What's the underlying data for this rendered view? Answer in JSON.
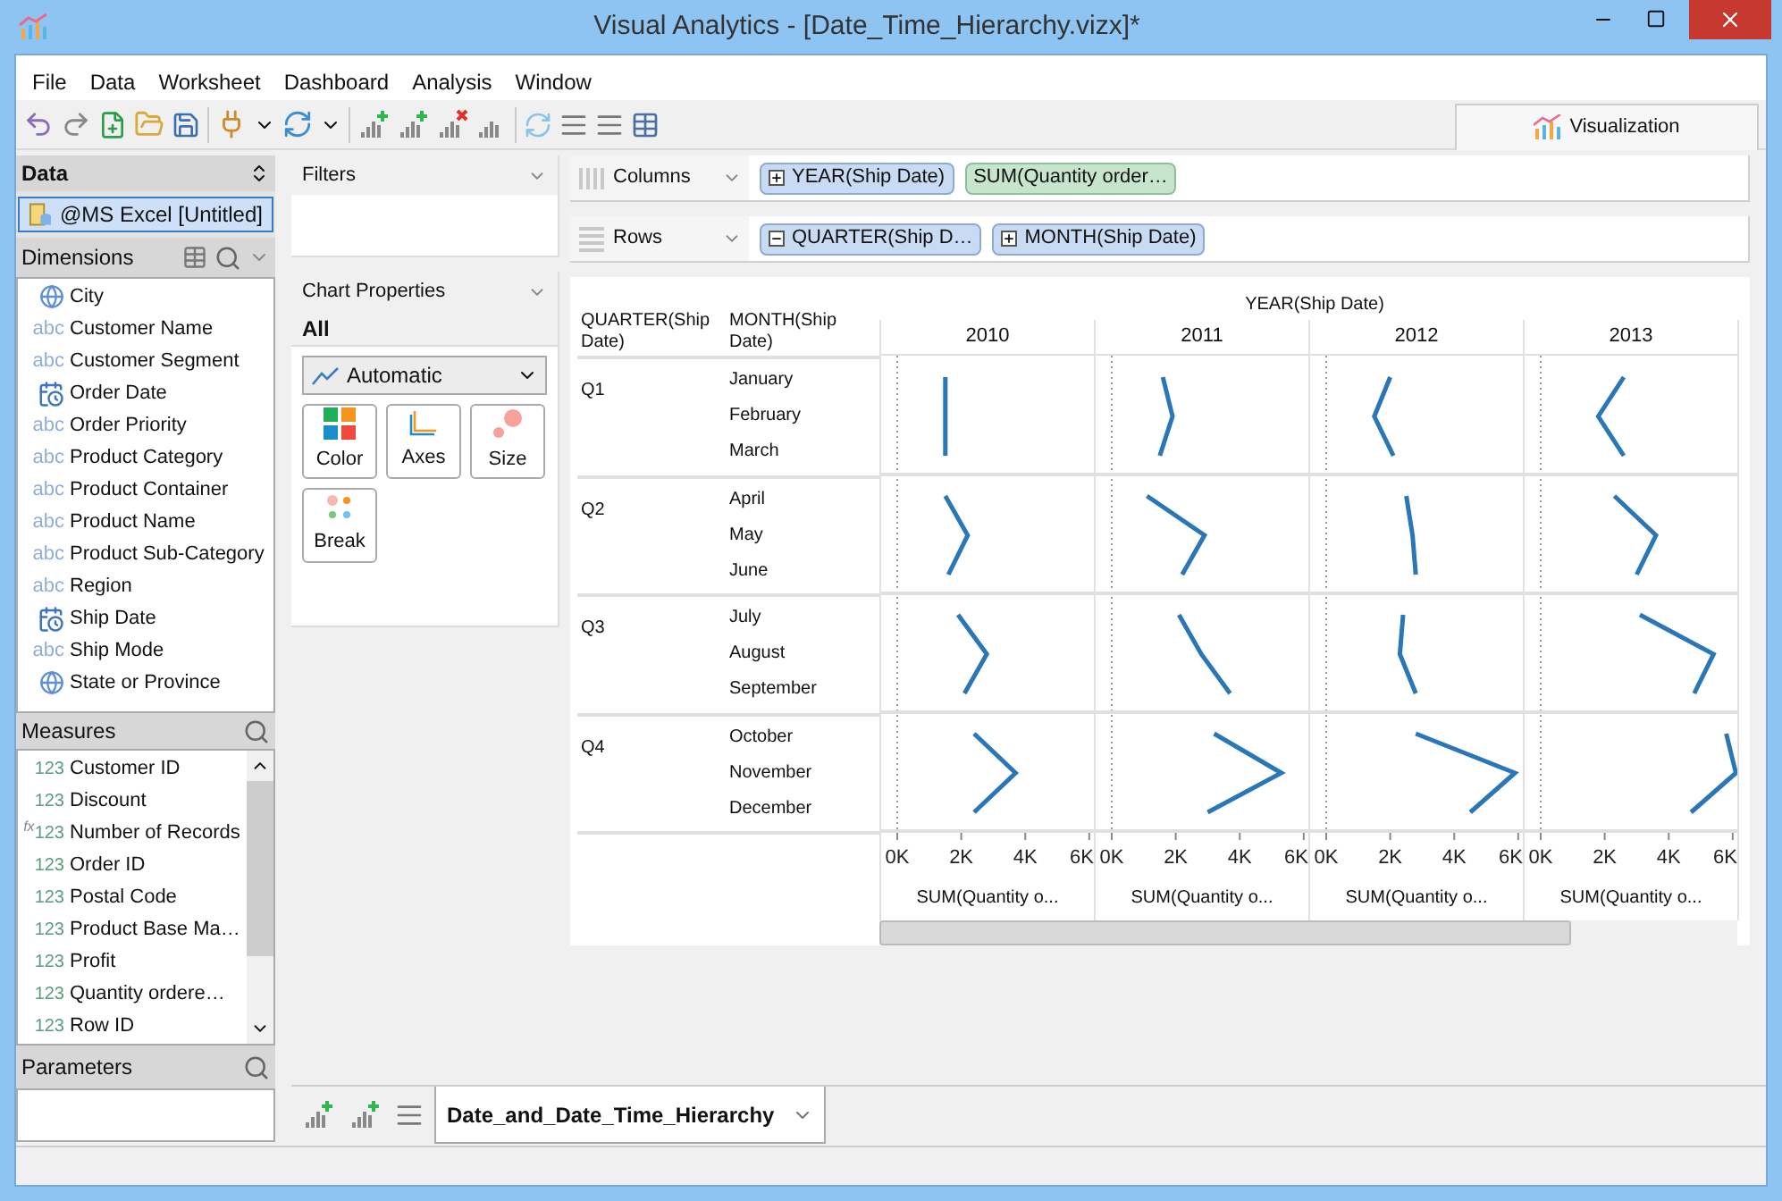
{
  "window": {
    "title": "Visual Analytics - [Date_Time_Hierarchy.vizx]*"
  },
  "menu": [
    "File",
    "Data",
    "Worksheet",
    "Dashboard",
    "Analysis",
    "Window"
  ],
  "toolbar_tab": {
    "label": "Visualization",
    "selected": true
  },
  "data_panel": {
    "title": "Data",
    "source": {
      "label": "@MS Excel [Untitled]",
      "selected": true
    },
    "dimensions": {
      "title": "Dimensions",
      "items": [
        {
          "label": "City",
          "kind": "geo"
        },
        {
          "label": "Customer Name",
          "kind": "text",
          "badge": "abc"
        },
        {
          "label": "Customer Segment",
          "kind": "text",
          "badge": "abc"
        },
        {
          "label": "Order Date",
          "kind": "date"
        },
        {
          "label": "Order Priority",
          "kind": "text",
          "badge": "abc"
        },
        {
          "label": "Product Category",
          "kind": "text",
          "badge": "abc"
        },
        {
          "label": "Product Container",
          "kind": "text",
          "badge": "abc"
        },
        {
          "label": "Product Name",
          "kind": "text",
          "badge": "abc"
        },
        {
          "label": "Product Sub-Category",
          "kind": "text",
          "badge": "abc"
        },
        {
          "label": "Region",
          "kind": "text",
          "badge": "abc"
        },
        {
          "label": "Ship Date",
          "kind": "date"
        },
        {
          "label": "Ship Mode",
          "kind": "text",
          "badge": "abc"
        },
        {
          "label": "State or Province",
          "kind": "geo"
        }
      ]
    },
    "measures": {
      "title": "Measures",
      "items": [
        {
          "label": "Customer ID",
          "kind": "number",
          "badge": "123"
        },
        {
          "label": "Discount",
          "kind": "number",
          "badge": "123"
        },
        {
          "label": "Number of Records",
          "kind": "calculated",
          "badge": "123",
          "prefix": "fx"
        },
        {
          "label": "Order ID",
          "kind": "number",
          "badge": "123"
        },
        {
          "label": "Postal Code",
          "kind": "number",
          "badge": "123"
        },
        {
          "label": "Product Base Ma…",
          "kind": "number",
          "badge": "123"
        },
        {
          "label": "Profit",
          "kind": "number",
          "badge": "123"
        },
        {
          "label": "Quantity ordere…",
          "kind": "number",
          "badge": "123"
        },
        {
          "label": "Row ID",
          "kind": "number",
          "badge": "123"
        }
      ]
    },
    "parameters": {
      "title": "Parameters"
    }
  },
  "filters": {
    "title": "Filters"
  },
  "chart_properties": {
    "title": "Chart Properties",
    "scope": "All",
    "mark_type": "Automatic",
    "buttons": [
      {
        "label": "Color",
        "kind": "color"
      },
      {
        "label": "Axes",
        "kind": "axes"
      },
      {
        "label": "Size",
        "kind": "size"
      },
      {
        "label": "Break",
        "kind": "break"
      }
    ]
  },
  "shelves": [
    {
      "label": "Columns",
      "kind": "columns",
      "pills": [
        {
          "label": "YEAR(Ship Date)",
          "kind": "dimension",
          "expanded": false
        },
        {
          "label": "SUM(Quantity order…",
          "kind": "measure"
        }
      ]
    },
    {
      "label": "Rows",
      "kind": "rows",
      "pills": [
        {
          "label": "QUARTER(Ship D…",
          "kind": "dimension",
          "expanded": true
        },
        {
          "label": "MONTH(Ship Date)",
          "kind": "dimension",
          "expanded": false
        }
      ]
    }
  ],
  "view": {
    "row_headers": [
      "QUARTER(Ship Date)",
      "MONTH(Ship Date)"
    ],
    "column_header": "YEAR(Ship Date)",
    "quarters": [
      {
        "label": "Q1",
        "months": [
          "January",
          "February",
          "March"
        ]
      },
      {
        "label": "Q2",
        "months": [
          "April",
          "May",
          "June"
        ]
      },
      {
        "label": "Q3",
        "months": [
          "July",
          "August",
          "September"
        ]
      },
      {
        "label": "Q4",
        "months": [
          "October",
          "November",
          "December"
        ]
      }
    ],
    "panels": [
      {
        "year": "2010",
        "axis_label": "SUM(Quantity o...",
        "chart_data": {
          "type": "line",
          "orientation": "horizontal",
          "xlim": [
            0,
            6200
          ],
          "xticks": [
            {
              "value": 0,
              "label": "0K"
            },
            {
              "value": 2000,
              "label": "2K"
            },
            {
              "value": 4000,
              "label": "4K"
            },
            {
              "value": 6000,
              "label": "6K"
            }
          ],
          "series": [
            {
              "color": "#2a77b8",
              "values": [
                1500,
                1500,
                1500,
                1500,
                2200,
                1600,
                1900,
                2800,
                2100,
                2400,
                3700,
                2400
              ]
            }
          ]
        }
      },
      {
        "year": "2011",
        "axis_label": "SUM(Quantity o...",
        "chart_data": {
          "type": "line",
          "orientation": "horizontal",
          "xlim": [
            0,
            6200
          ],
          "xticks": [
            {
              "value": 0,
              "label": "0K"
            },
            {
              "value": 2000,
              "label": "2K"
            },
            {
              "value": 4000,
              "label": "4K"
            },
            {
              "value": 6000,
              "label": "6K"
            }
          ],
          "series": [
            {
              "color": "#2a77b8",
              "values": [
                1600,
                1900,
                1500,
                1100,
                2900,
                2200,
                2100,
                2800,
                3700,
                3200,
                5300,
                3000
              ]
            }
          ]
        }
      },
      {
        "year": "2012",
        "axis_label": "SUM(Quantity o...",
        "chart_data": {
          "type": "line",
          "orientation": "horizontal",
          "xlim": [
            0,
            6200
          ],
          "xticks": [
            {
              "value": 0,
              "label": "0K"
            },
            {
              "value": 2000,
              "label": "2K"
            },
            {
              "value": 4000,
              "label": "4K"
            },
            {
              "value": 6000,
              "label": "6K"
            }
          ],
          "series": [
            {
              "color": "#2a77b8",
              "values": [
                2000,
                1500,
                2100,
                2500,
                2700,
                2800,
                2400,
                2300,
                2800,
                2800,
                5900,
                4500
              ]
            }
          ]
        }
      },
      {
        "year": "2013",
        "axis_label": "SUM(Quantity o...",
        "chart_data": {
          "type": "line",
          "orientation": "horizontal",
          "xlim": [
            0,
            6200
          ],
          "xticks": [
            {
              "value": 0,
              "label": "0K"
            },
            {
              "value": 2000,
              "label": "2K"
            },
            {
              "value": 4000,
              "label": "4K"
            },
            {
              "value": 6000,
              "label": "6K"
            }
          ],
          "series": [
            {
              "color": "#2a77b8",
              "values": [
                2600,
                1800,
                2600,
                2300,
                3600,
                3000,
                3100,
                5400,
                4800,
                5800,
                6100,
                4700
              ]
            }
          ]
        }
      }
    ]
  },
  "sheet_tabs": [
    {
      "label": "Date_and_Date_Time_Hierarchy",
      "selected": true
    }
  ]
}
